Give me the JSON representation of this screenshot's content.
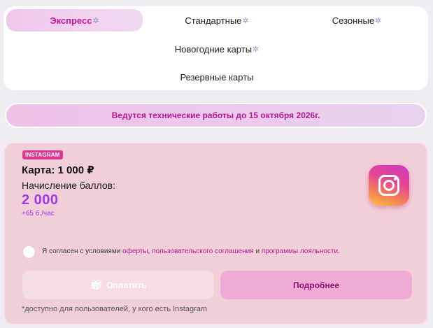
{
  "tabs": [
    {
      "label": "Экспресс",
      "active": true
    },
    {
      "label": "Стандартные",
      "active": false
    },
    {
      "label": "Сезонные",
      "active": false
    },
    {
      "label": "Новогодние карты",
      "active": false
    },
    {
      "label": "Резервные карты",
      "active": false
    }
  ],
  "tab_icon": "gear-icon",
  "banner": {
    "text": "Ведутся технические работы до 15 октября 2026г."
  },
  "offer": {
    "badge": "INSTAGRAM",
    "title": "Карта: 1 000 ₽",
    "points_label": "Начисление баллов:",
    "points_value": "2 000",
    "rate": "+65 б./час",
    "icon": "instagram-icon",
    "agreement": {
      "prefix": "Я согласен с условиями ",
      "link1": "оферты",
      "sep1": ", ",
      "link2": "пользовательского соглашения",
      "sep2": " и ",
      "link3": "программы лояльности",
      "suffix": "."
    },
    "pay_button": "Оплатить",
    "more_button": "Подробнее",
    "footnote": "*доступно для пользователей, у кого есть Instagram"
  },
  "colors": {
    "accent": "#b21892",
    "points": "#9d3ae8",
    "card_bg": "#f1cfd8",
    "more_button": "#efaad6"
  }
}
